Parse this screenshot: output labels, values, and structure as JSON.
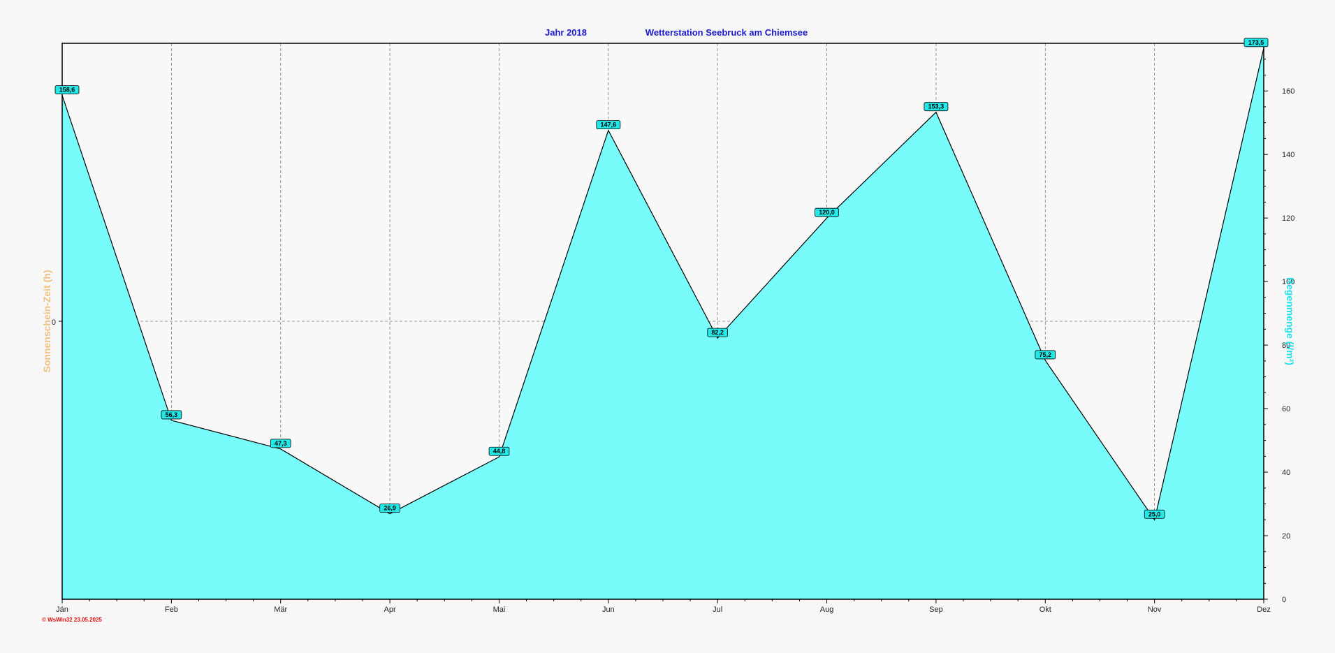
{
  "colors": {
    "fill": "#77fbfb",
    "stroke": "#000000",
    "title": "#1a1acc",
    "left_axis": "#f0c080",
    "right_axis": "#21e0e6",
    "footer": "#e01010",
    "label_bg": "#22e8e8"
  },
  "title": {
    "year": "Jahr  2018",
    "station": "Wetterstation Seebruck am Chiemsee"
  },
  "left_axis_title": "Sonnenschein-Zeit  (h)",
  "left_axis_zero": "0",
  "right_axis_title": "Regenmenge  (l/m²)",
  "footer": "© WsWin32  23.05.2025",
  "chart_data": {
    "type": "area",
    "categories": [
      "Jän",
      "Feb",
      "Mär",
      "Apr",
      "Mai",
      "Jun",
      "Jul",
      "Aug",
      "Sep",
      "Okt",
      "Nov",
      "Dez"
    ],
    "values": [
      158.6,
      56.3,
      47.3,
      26.9,
      44.8,
      147.6,
      82.2,
      120.0,
      153.3,
      75.2,
      25.0,
      173.5
    ],
    "value_labels": [
      "158,6",
      "56,3",
      "47,3",
      "26,9",
      "44,8",
      "147,6",
      "82,2",
      "120,0",
      "153,3",
      "75,2",
      "25,0",
      "173,5"
    ],
    "y_right_ticks": [
      "0",
      "20",
      "40",
      "60",
      "80",
      "100",
      "120",
      "140",
      "160"
    ],
    "y_right_range": [
      0,
      175
    ],
    "left_axis_ticks": [
      "0"
    ],
    "grid": true
  }
}
